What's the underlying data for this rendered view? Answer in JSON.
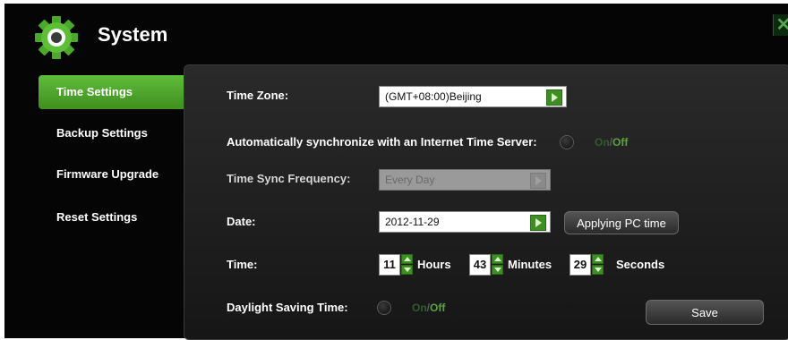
{
  "app": {
    "title": "System",
    "accent": "#4caf2a"
  },
  "icons": {
    "header": "gear-icon",
    "close": "close-icon"
  },
  "sidebar": {
    "items": [
      {
        "label": "Time Settings",
        "active": true
      },
      {
        "label": "Backup Settings",
        "active": false
      },
      {
        "label": "Firmware Upgrade",
        "active": false
      },
      {
        "label": "Reset Settings",
        "active": false
      }
    ]
  },
  "form": {
    "time_zone_label": "Time Zone:",
    "time_zone_value": "(GMT+08:00)Beijing",
    "auto_sync_label": "Automatically synchronize with an Internet Time Server:",
    "auto_sync_on": "On",
    "auto_sync_slash": "/",
    "auto_sync_off": "Off",
    "sync_freq_label": "Time Sync Frequency:",
    "sync_freq_value": "Every Day",
    "date_label": "Date:",
    "date_value": "2012-11-29",
    "apply_pc_time": "Applying PC time",
    "time_label": "Time:",
    "hours_value": "11",
    "hours_label": "Hours",
    "minutes_value": "43",
    "minutes_label": "Minutes",
    "seconds_value": "29",
    "seconds_label": "Seconds",
    "dst_label": "Daylight Saving Time:",
    "dst_on": "On",
    "dst_slash": "/",
    "dst_off": "Off",
    "save": "Save"
  }
}
